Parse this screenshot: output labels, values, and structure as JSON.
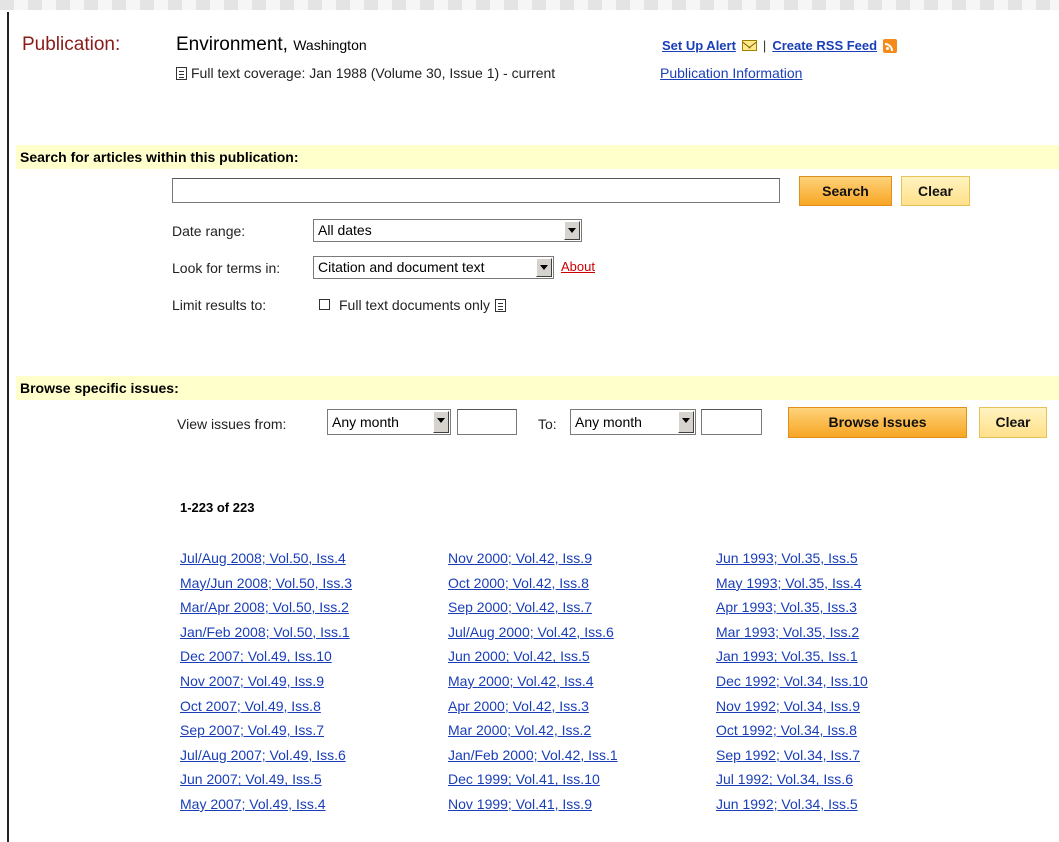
{
  "header": {
    "label": "Publication:",
    "title": "Environment,",
    "subtitle": "Washington",
    "coverage": "Full text coverage: Jan 1988 (Volume 30, Issue 1) - current",
    "pub_info_link": "Publication Information",
    "set_up_alert": "Set Up Alert",
    "separator": "|",
    "create_rss": "Create RSS Feed"
  },
  "search": {
    "bar_title": "Search for articles within this publication:",
    "query_value": "",
    "search_button": "Search",
    "clear_button": "Clear",
    "date_range_label": "Date range:",
    "date_range_value": "All dates",
    "look_for_label": "Look for terms in:",
    "look_for_value": "Citation and document text",
    "about_link": "About",
    "limit_label": "Limit results to:",
    "full_text_only": "Full text documents only"
  },
  "browse": {
    "bar_title": "Browse specific issues:",
    "view_from_label": "View issues from:",
    "from_month": "Any month",
    "from_year": "",
    "to_label": "To:",
    "to_month": "Any month",
    "to_year": "",
    "browse_button": "Browse Issues",
    "clear_button": "Clear"
  },
  "results": {
    "count": "1-223 of 223",
    "columns": [
      [
        "Jul/Aug 2008; Vol.50, Iss.4",
        "May/Jun 2008; Vol.50, Iss.3",
        "Mar/Apr 2008; Vol.50, Iss.2",
        "Jan/Feb 2008; Vol.50, Iss.1",
        "Dec 2007; Vol.49, Iss.10",
        "Nov 2007; Vol.49, Iss.9",
        "Oct 2007; Vol.49, Iss.8",
        "Sep 2007; Vol.49, Iss.7",
        "Jul/Aug 2007; Vol.49, Iss.6",
        "Jun 2007; Vol.49, Iss.5",
        "May 2007; Vol.49, Iss.4"
      ],
      [
        "Nov 2000; Vol.42, Iss.9",
        "Oct 2000; Vol.42, Iss.8",
        "Sep 2000; Vol.42, Iss.7",
        "Jul/Aug 2000; Vol.42, Iss.6",
        "Jun 2000; Vol.42, Iss.5",
        "May 2000; Vol.42, Iss.4",
        "Apr 2000; Vol.42, Iss.3",
        "Mar 2000; Vol.42, Iss.2",
        "Jan/Feb 2000; Vol.42, Iss.1",
        "Dec 1999; Vol.41, Iss.10",
        "Nov 1999; Vol.41, Iss.9"
      ],
      [
        "Jun 1993; Vol.35, Iss.5",
        "May 1993; Vol.35, Iss.4",
        "Apr 1993; Vol.35, Iss.3",
        "Mar 1993; Vol.35, Iss.2",
        "Jan 1993; Vol.35, Iss.1",
        "Dec 1992; Vol.34, Iss.10",
        "Nov 1992; Vol.34, Iss.9",
        "Oct 1992; Vol.34, Iss.8",
        "Sep 1992; Vol.34, Iss.7",
        "Jul 1992; Vol.34, Iss.6",
        "Jun 1992; Vol.34, Iss.5"
      ]
    ]
  },
  "colors": {
    "label_red": "#8b1a1a",
    "link_blue": "#1a3eb8",
    "bar_yellow": "#ffffcc",
    "button_orange": "#f7a623"
  },
  "icons": [
    "document-icon",
    "mail-icon",
    "rss-icon",
    "dropdown-arrow-icon",
    "checkbox"
  ]
}
